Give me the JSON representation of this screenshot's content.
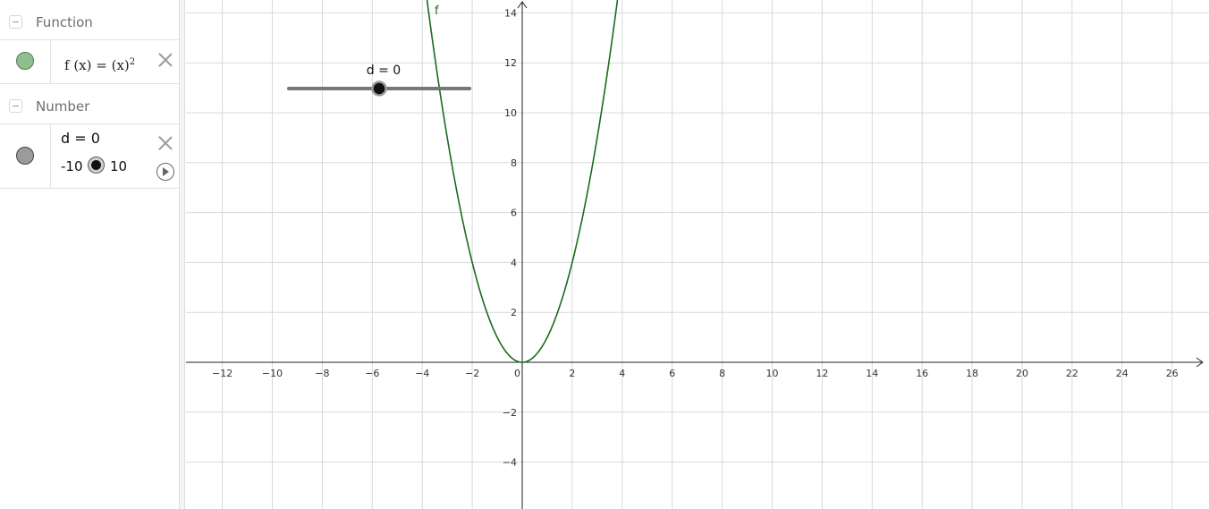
{
  "algebra": {
    "function_group": {
      "label": "Function"
    },
    "function_item": {
      "label": "f (x)  =  (x)",
      "exponent": "2",
      "color": "#8fbf8f"
    },
    "number_group": {
      "label": "Number"
    },
    "number_item": {
      "definition": "d = 0",
      "min": "-10",
      "max": "10",
      "color": "#9b9b9b"
    }
  },
  "graphics": {
    "slider_caption": "d = 0",
    "curve_label": "f",
    "curve_color": "#1b6b1b",
    "x_ticks": [
      "−12",
      "−10",
      "−8",
      "−6",
      "−4",
      "−2",
      "0",
      "2",
      "4",
      "6",
      "8",
      "10",
      "12",
      "14",
      "16",
      "18",
      "20",
      "22",
      "24",
      "26"
    ],
    "y_ticks_pos": [
      "2",
      "4",
      "6",
      "8",
      "10",
      "12",
      "14"
    ],
    "y_ticks_neg": [
      "−2",
      "−4"
    ]
  },
  "chart_data": {
    "type": "line",
    "series": [
      {
        "name": "f",
        "equation": "f(x) = (x)^2",
        "x_range": [
          -13.5,
          27.5
        ]
      }
    ],
    "slider": {
      "name": "d",
      "value": 0,
      "min": -10,
      "max": 10
    },
    "xlim": [
      -13.5,
      27.5
    ],
    "ylim": [
      -5.8,
      14.5
    ],
    "grid": true
  }
}
